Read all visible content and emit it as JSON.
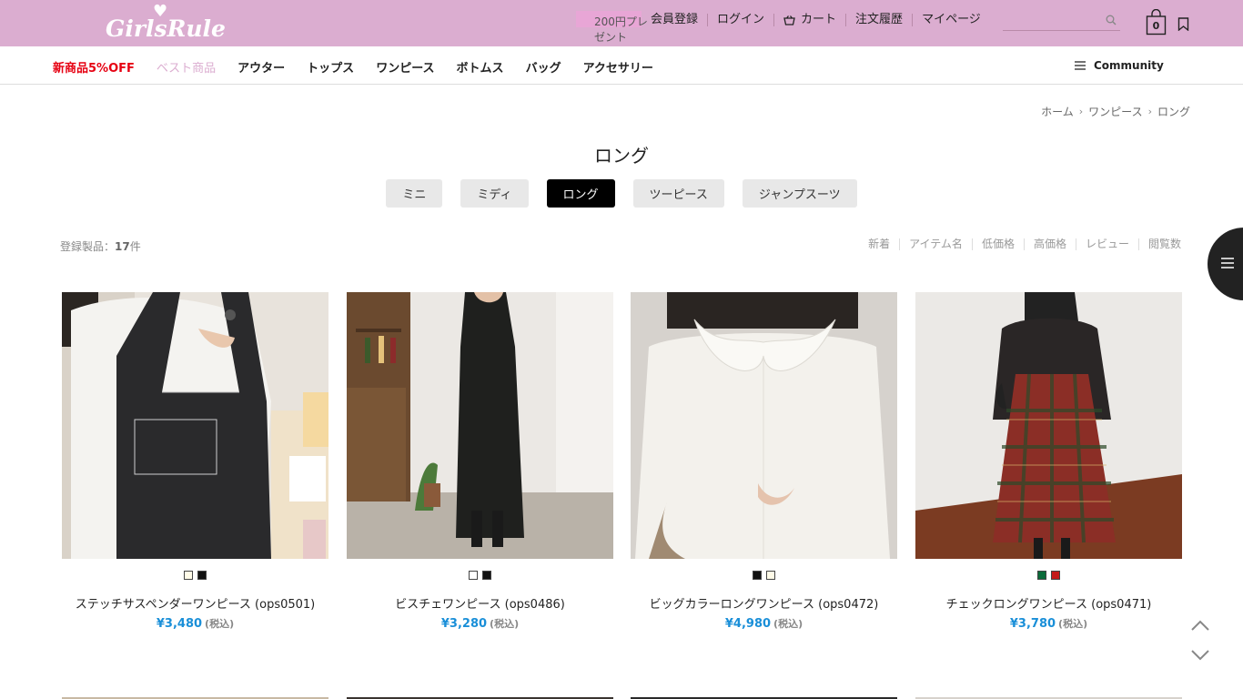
{
  "brand": {
    "logo_text": "GirlsRule"
  },
  "header": {
    "promo": "200円プレゼント",
    "nav": [
      "会員登録",
      "ログイン",
      "カート",
      "注文履歴",
      "マイページ"
    ],
    "cart_count": "0"
  },
  "categories": {
    "items": [
      "新商品5%OFF",
      "ベスト商品",
      "アウター",
      "トップス",
      "ワンピース",
      "ボトムス",
      "バッグ",
      "アクセサリー"
    ],
    "colors": [
      "#e60012",
      "#dbadd0",
      "#111111",
      "#111111",
      "#111111",
      "#111111",
      "#111111",
      "#111111"
    ],
    "community": "Community"
  },
  "breadcrumb": [
    "ホーム",
    "ワンピース",
    "ロング"
  ],
  "page": {
    "title": "ロング",
    "subtabs": [
      "ミニ",
      "ミディ",
      "ロング",
      "ツーピース",
      "ジャンプスーツ"
    ],
    "active_subtab": "ロング",
    "count_label": "登録製品：",
    "count_value": "17",
    "count_unit": "件"
  },
  "sort": [
    "新着",
    "アイテム名",
    "低価格",
    "高価格",
    "レビュー",
    "閲覧数"
  ],
  "products": [
    {
      "name": "ステッチサスペンダーワンピース (ops0501)",
      "price": "¥3,480",
      "tax": "(税込)",
      "swatches": [
        "#fffbe8",
        "#111111"
      ],
      "image": "black suspender dress over white top"
    },
    {
      "name": "ビスチェワンピース (ops0486)",
      "price": "¥3,280",
      "tax": "(税込)",
      "swatches": [
        "#ffffff",
        "#111111"
      ],
      "image": "black long bustier dress"
    },
    {
      "name": "ビッグカラーロングワンピース (ops0472)",
      "price": "¥4,980",
      "tax": "(税込)",
      "swatches": [
        "#111111",
        "#fffbe8"
      ],
      "image": "white big collar long dress"
    },
    {
      "name": "チェックロングワンピース (ops0471)",
      "price": "¥3,780",
      "tax": "(税込)",
      "swatches": [
        "#0b6b3a",
        "#c41b1b"
      ],
      "image": "red green check long dress"
    }
  ],
  "icons": [
    "heart-icon",
    "cart-icon",
    "search-icon",
    "bag-icon",
    "bookmark-icon",
    "hamburger-icon",
    "chevron-right-icon",
    "chevron-up-icon",
    "chevron-down-icon"
  ]
}
